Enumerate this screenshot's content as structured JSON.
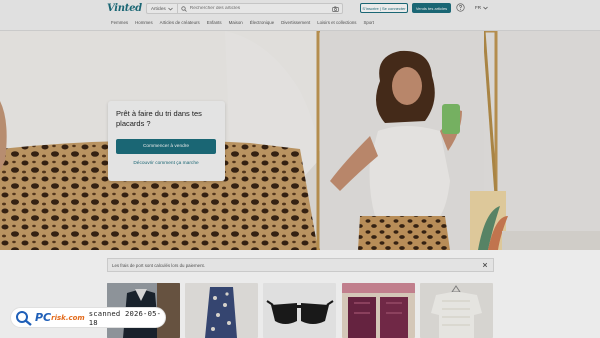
{
  "header": {
    "logo": "Vinted",
    "category_select": "Articles",
    "search_placeholder": "Rechercher des articles",
    "login_label": "S'inscrire | Se connecter",
    "sell_label": "Vends tes articles",
    "language": "FR"
  },
  "nav": {
    "items": [
      "Femmes",
      "Hommes",
      "Articles de créateurs",
      "Enfants",
      "Maison",
      "Électronique",
      "Divertissement",
      "Loisirs et collections",
      "Sport"
    ]
  },
  "hero_card": {
    "title": "Prêt à faire du tri dans tes placards ?",
    "cta_label": "Commencer à vendre",
    "link_label": "Découvrir comment ça marche"
  },
  "notice": {
    "text": "Les frais de port sont calculés lors du paiement."
  },
  "watermark": {
    "brand_pc": "PC",
    "brand_risk": "risk.com",
    "scan_text": "scanned 2026-05-18"
  },
  "colors": {
    "accent": "#1d6f7e",
    "watermark_blue": "#1f5fb8",
    "watermark_orange": "#e36b1c"
  },
  "icons": [
    "search-icon",
    "camera-icon",
    "help-icon",
    "chevron-down-icon",
    "close-icon"
  ]
}
